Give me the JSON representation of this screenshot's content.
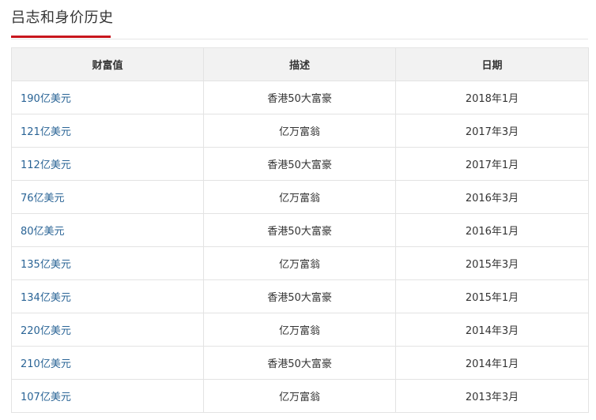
{
  "section": {
    "title": "吕志和身价历史"
  },
  "table": {
    "headers": [
      "财富值",
      "描述",
      "日期"
    ],
    "rows": [
      {
        "wealth": "190亿美元",
        "desc": "香港50大富豪",
        "date": "2018年1月"
      },
      {
        "wealth": "121亿美元",
        "desc": "亿万富翁",
        "date": "2017年3月"
      },
      {
        "wealth": "112亿美元",
        "desc": "香港50大富豪",
        "date": "2017年1月"
      },
      {
        "wealth": "76亿美元",
        "desc": "亿万富翁",
        "date": "2016年3月"
      },
      {
        "wealth": "80亿美元",
        "desc": "香港50大富豪",
        "date": "2016年1月"
      },
      {
        "wealth": "135亿美元",
        "desc": "亿万富翁",
        "date": "2015年3月"
      },
      {
        "wealth": "134亿美元",
        "desc": "香港50大富豪",
        "date": "2015年1月"
      },
      {
        "wealth": "220亿美元",
        "desc": "亿万富翁",
        "date": "2014年3月"
      },
      {
        "wealth": "210亿美元",
        "desc": "香港50大富豪",
        "date": "2014年1月"
      },
      {
        "wealth": "107亿美元",
        "desc": "亿万富翁",
        "date": "2013年3月"
      }
    ]
  },
  "colors": {
    "accent": "#c8161d",
    "link": "#2a6496",
    "header_bg": "#f2f2f2",
    "border": "#e3e3e3"
  }
}
